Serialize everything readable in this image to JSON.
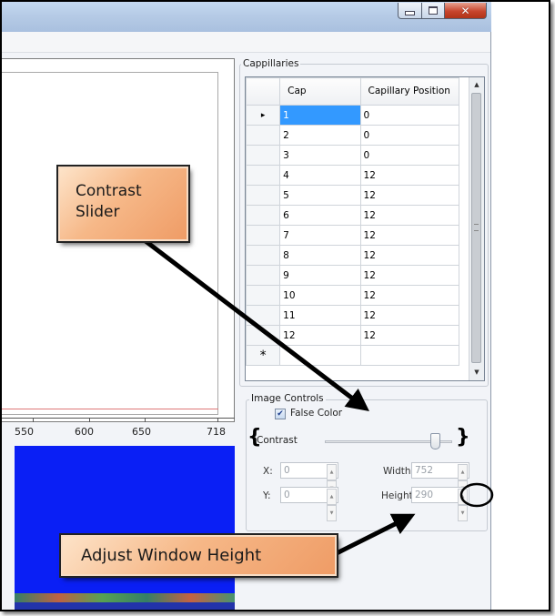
{
  "window": {
    "controls": [
      "minimize",
      "maximize",
      "close"
    ]
  },
  "plot": {
    "x_ticks": [
      "550",
      "600",
      "650",
      "718"
    ]
  },
  "capillaries": {
    "group_title": "Cappillaries",
    "columns": [
      "Cap",
      "Capillary Position"
    ],
    "rows": [
      {
        "cap": "1",
        "position": "0"
      },
      {
        "cap": "2",
        "position": "0"
      },
      {
        "cap": "3",
        "position": "0"
      },
      {
        "cap": "4",
        "position": "12"
      },
      {
        "cap": "5",
        "position": "12"
      },
      {
        "cap": "6",
        "position": "12"
      },
      {
        "cap": "7",
        "position": "12"
      },
      {
        "cap": "8",
        "position": "12"
      },
      {
        "cap": "9",
        "position": "12"
      },
      {
        "cap": "10",
        "position": "12"
      },
      {
        "cap": "11",
        "position": "12"
      },
      {
        "cap": "12",
        "position": "12"
      }
    ],
    "new_row_marker": "*",
    "current_row_marker": "▸"
  },
  "image_controls": {
    "group_title": "Image Controls",
    "false_color_label": "False Color",
    "false_color_checked": true,
    "contrast_label": "Contrast",
    "contrast_level": 0.9,
    "x_label": "X:",
    "x_value": "0",
    "y_label": "Y:",
    "y_value": "0",
    "width_label": "Width:",
    "width_value": "752",
    "height_label": "Height:",
    "height_value": "290"
  },
  "annotations": {
    "contrast_callout": "Contrast Slider",
    "height_callout": "Adjust Window Height",
    "brace_left": "{",
    "brace_right": "}"
  },
  "colors": {
    "selection": "#3399ff",
    "spectrum": "#0a1ff5",
    "callout": "#f6b888"
  }
}
